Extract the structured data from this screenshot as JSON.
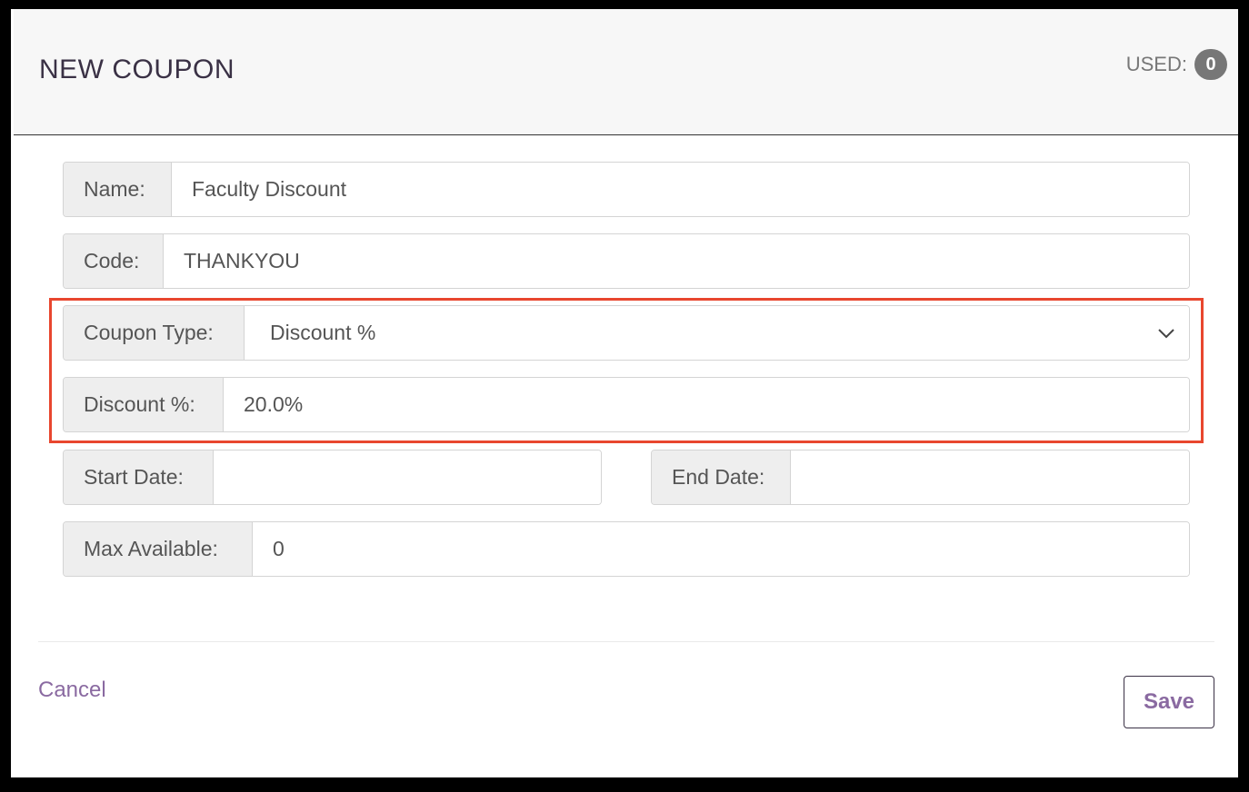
{
  "modal": {
    "title": "NEW COUPON",
    "used_label": "USED:",
    "used_count": "0"
  },
  "form": {
    "name": {
      "label": "Name:",
      "value": "Faculty Discount"
    },
    "code": {
      "label": "Code:",
      "value": "THANKYOU"
    },
    "coupon_type": {
      "label": "Coupon Type:",
      "value": "Discount %",
      "icon": "chevron-down-icon"
    },
    "discount": {
      "label": "Discount %:",
      "value": "20.0%"
    },
    "start_date": {
      "label": "Start Date:",
      "value": ""
    },
    "end_date": {
      "label": "End Date:",
      "value": ""
    },
    "max_available": {
      "label": "Max Available:",
      "value": "0"
    }
  },
  "footer": {
    "cancel_label": "Cancel",
    "save_label": "Save"
  },
  "colors": {
    "highlight": "#e8462e",
    "accent": "#8a6aa1",
    "badge": "#777777"
  }
}
